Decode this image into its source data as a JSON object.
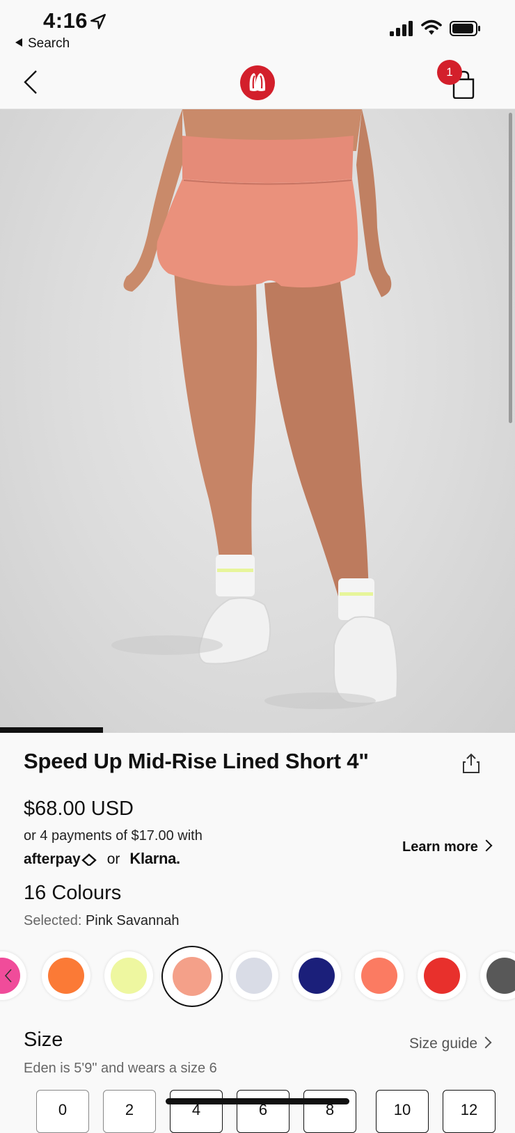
{
  "status_bar": {
    "time": "4:16",
    "back_app": "Search"
  },
  "header": {
    "cart_count": "1",
    "logo": "lululemon-logo",
    "back_icon": "chevron-left-icon",
    "cart_icon": "shopping-bag-icon"
  },
  "product": {
    "title": "Speed Up Mid-Rise Lined Short 4\"",
    "price": "$68.00 USD",
    "installments": "or 4 payments of $17.00 with",
    "afterpay": "afterpay",
    "or": "or",
    "klarna": "Klarna.",
    "learn_more": "Learn more",
    "image_index_progress": 0.2
  },
  "colours": {
    "heading": "16 Colours",
    "selected_label": "Selected:",
    "selected_value": "Pink Savannah",
    "swatches": [
      "#f04c9a",
      "#fb7a36",
      "#eef7a0",
      "#f4a089",
      "#d9dce6",
      "#1b1f7a",
      "#fb7b62",
      "#e8302c",
      "#585858"
    ]
  },
  "size": {
    "heading": "Size",
    "guide": "Size guide",
    "model_note": "Eden is 5'9\" and wears a size 6",
    "options": [
      "0",
      "2",
      "4",
      "6",
      "8",
      "10",
      "12"
    ]
  }
}
